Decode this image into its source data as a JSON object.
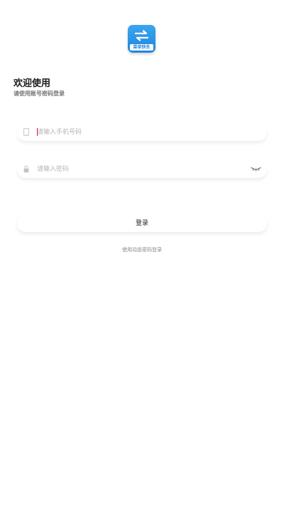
{
  "logo": {
    "caption": "菜单快车",
    "icon": "swap-arrows-icon",
    "background": "#2a95e6"
  },
  "header": {
    "title": "欢迎使用",
    "subtitle": "请使用账号密码登录"
  },
  "form": {
    "phone": {
      "placeholder": "请输入手机号码",
      "value": "",
      "icon": "phone-icon"
    },
    "password": {
      "placeholder": "请输入密码",
      "value": "",
      "icon": "lock-icon",
      "toggle_icon": "eye-closed-icon"
    },
    "login_label": "登录",
    "alt_login_label": "使用动态密码登录"
  }
}
